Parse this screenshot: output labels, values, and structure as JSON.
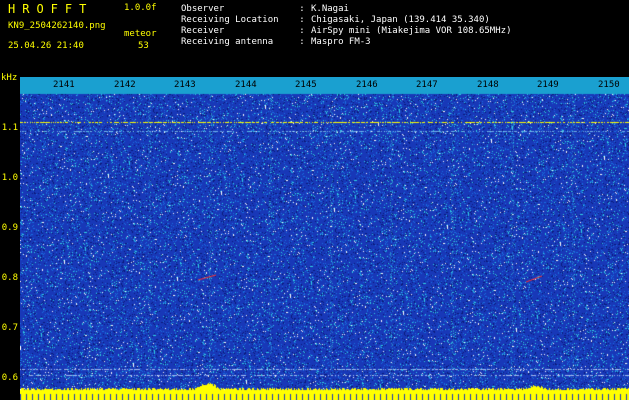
{
  "header": {
    "app_title": "HROFFT",
    "version": "1.0.0f",
    "file_name": "KN9_2504262140.png",
    "mode": "meteor",
    "timestamp": "25.04.26 21:40",
    "count": "53"
  },
  "info": [
    {
      "label": "Observer",
      "value": "K.Nagai"
    },
    {
      "label": "Receiving Location",
      "value": "Chigasaki, Japan (139.414 35.340)"
    },
    {
      "label": "Receiver",
      "value": "AirSpy mini (Miakejima VOR 108.65MHz)"
    },
    {
      "label": "Receiving antenna",
      "value": "Maspro FM-3"
    }
  ],
  "info_separator": ":",
  "axis": {
    "unit": "kHz",
    "y_ticks": [
      "1.1",
      "1.0",
      "0.9",
      "0.8",
      "0.7",
      "0.6"
    ],
    "x_ticks": [
      "2141",
      "2142",
      "2143",
      "2144",
      "2145",
      "2146",
      "2147",
      "2148",
      "2149",
      "2150"
    ]
  },
  "colors": {
    "text_accent": "#ffff00",
    "background": "#000000",
    "spectrogram_base": "#1838b8",
    "time_band": "#1aa0d0",
    "carrier_line": "#ffff00",
    "meteor_trace": "#ff3030"
  }
}
